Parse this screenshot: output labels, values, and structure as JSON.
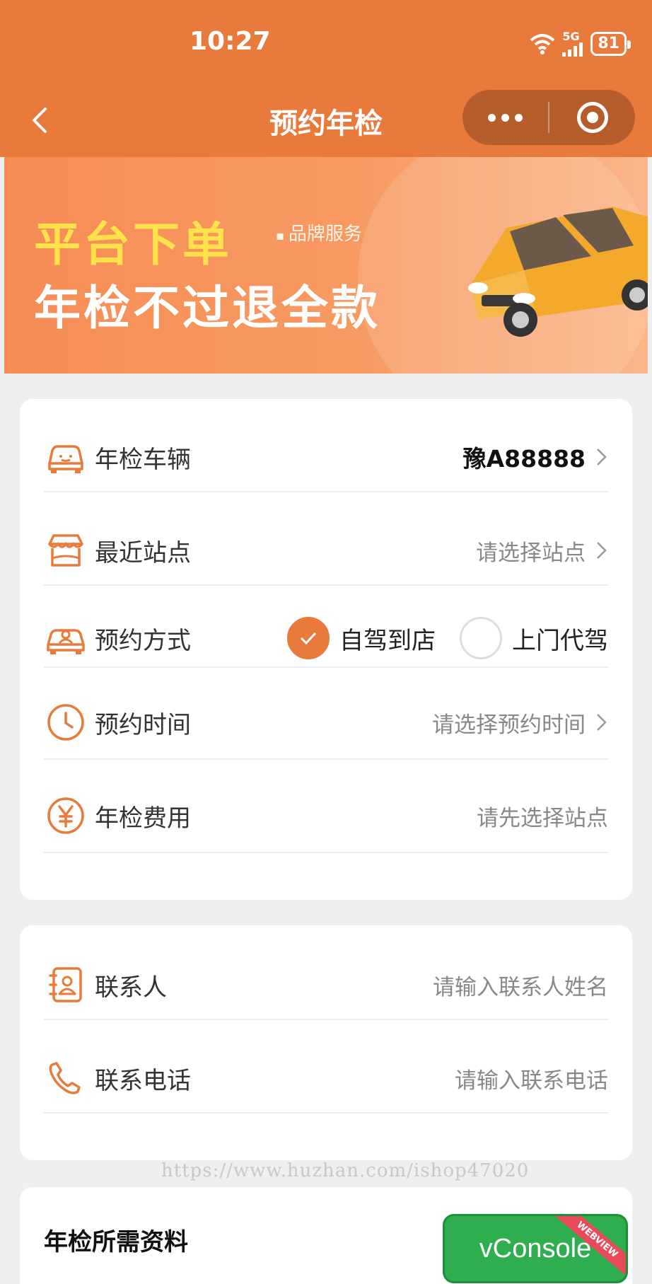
{
  "status_bar": {
    "time": "10:27",
    "network": "5G",
    "battery": "81"
  },
  "nav": {
    "title": "预约年检"
  },
  "banner": {
    "line1": "平台下单",
    "tag": "品牌服务",
    "line2": "年检不过退全款"
  },
  "form": {
    "vehicle": {
      "label": "年检车辆",
      "value": "豫A88888"
    },
    "station": {
      "label": "最近站点",
      "placeholder": "请选择站点"
    },
    "method": {
      "label": "预约方式",
      "options": [
        {
          "label": "自驾到店",
          "selected": true
        },
        {
          "label": "上门代驾",
          "selected": false
        }
      ]
    },
    "time": {
      "label": "预约时间",
      "placeholder": "请选择预约时间"
    },
    "fee": {
      "label": "年检费用",
      "value": "请先选择站点"
    }
  },
  "contact": {
    "name": {
      "label": "联系人",
      "placeholder": "请输入联系人姓名"
    },
    "phone": {
      "label": "联系电话",
      "placeholder": "请输入联系电话"
    }
  },
  "materials": {
    "title": "年检所需资料"
  },
  "watermark": "https://www.huzhan.com/ishop47020",
  "vconsole": {
    "label": "vConsole",
    "ribbon": "WEBVIEW"
  },
  "colors": {
    "accent": "#e87b3c",
    "header": "#e87b3c",
    "capsule": "#b65e2b",
    "vconsole": "#2fae4f"
  }
}
